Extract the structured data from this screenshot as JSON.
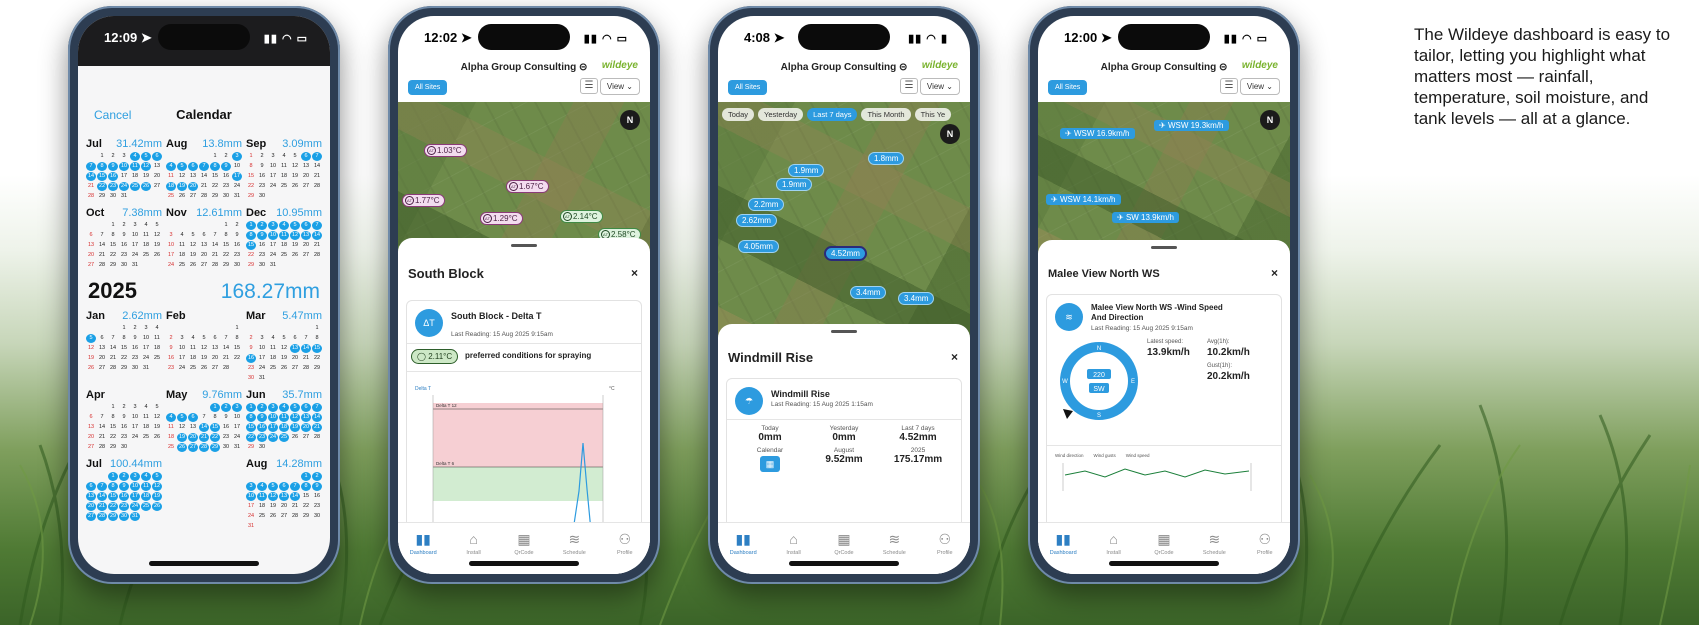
{
  "caption": "The Wildeye dashboard is easy to tailor, letting you highlight what matters most — rainfall, temperature, soil moisture, and tank levels — all at a glance.",
  "tabbar": [
    {
      "label": "Dashboard",
      "icon": "chart-icon"
    },
    {
      "label": "Install",
      "icon": "home-icon"
    },
    {
      "label": "QrCode",
      "icon": "qrcode-icon"
    },
    {
      "label": "Schedule",
      "icon": "waves-icon"
    },
    {
      "label": "Profile",
      "icon": "person-icon"
    }
  ],
  "header": {
    "org": "Alpha Group Consulting ⊝",
    "logo": "wildeye",
    "all_sites": "All Sites",
    "view": "View ⌄"
  },
  "phone1": {
    "time": "12:09 ➤",
    "cancel": "Cancel",
    "title": "Calendar",
    "year": "2025",
    "year_total": "168.27mm",
    "months_2024": [
      {
        "name": "Jul",
        "total": "31.42mm"
      },
      {
        "name": "Aug",
        "total": "13.8mm"
      },
      {
        "name": "Sep",
        "total": "3.09mm"
      },
      {
        "name": "Oct",
        "total": "7.38mm"
      },
      {
        "name": "Nov",
        "total": "12.61mm"
      },
      {
        "name": "Dec",
        "total": "10.95mm"
      }
    ],
    "months_2025": [
      {
        "name": "Jan",
        "total": "2.62mm"
      },
      {
        "name": "Feb",
        "total": ""
      },
      {
        "name": "Mar",
        "total": "5.47mm"
      },
      {
        "name": "Apr",
        "total": ""
      },
      {
        "name": "May",
        "total": "9.76mm"
      },
      {
        "name": "Jun",
        "total": "35.7mm"
      },
      {
        "name": "Jul",
        "total": "100.44mm"
      },
      {
        "name": "Aug",
        "total": "14.28mm"
      },
      {
        "name": "",
        "total": ""
      }
    ]
  },
  "phone2": {
    "time": "12:02 ➤",
    "pins": [
      "1.03°C",
      "1.77°C",
      "1.67°C",
      "1.29°C",
      "2.14°C",
      "2.58°C"
    ],
    "sheet_title": "South Block",
    "close": "×",
    "card_title": "South Block - Delta T",
    "badge": "ΔT",
    "last_reading": "Last Reading: 15 Aug 2025 9:15am",
    "reading_value": "2.11°C",
    "reading_text": "preferred conditions for spraying",
    "chart_unit_left": "Delta T",
    "chart_unit_right": "°C",
    "band_high": "Delta T 12",
    "band_low": "Delta T 6"
  },
  "phone3": {
    "time": "4:08 ➤",
    "chips": [
      "Today",
      "Yesterday",
      "Last 7 days",
      "This Month",
      "This Ye"
    ],
    "pins": [
      "1.8mm",
      "1.9mm",
      "1.9mm",
      "2.2mm",
      "2.62mm",
      "4.05mm",
      "4.52mm",
      "3.4mm",
      "3.4mm"
    ],
    "sheet_title": "Windmill Rise",
    "close": "×",
    "card_title": "Windmill Rise",
    "last_reading": "Last Reading: 15 Aug 2025 1:15am",
    "stats": [
      {
        "label": "Today",
        "value": "0mm"
      },
      {
        "label": "Yesterday",
        "value": "0mm"
      },
      {
        "label": "Last 7 days",
        "value": "4.52mm"
      },
      {
        "label": "Calendar",
        "value": ""
      },
      {
        "label": "August",
        "value": "9.52mm"
      },
      {
        "label": "2025",
        "value": "175.17mm"
      }
    ]
  },
  "phone4": {
    "time": "12:00 ➤",
    "pins": [
      "WSW 16.9km/h",
      "WSW 19.3km/h",
      "WSW 14.1km/h",
      "SW 13.9km/h"
    ],
    "sheet_title": "Malee View North WS",
    "close": "×",
    "card_title": "Malee View North WS -Wind Speed And Direction",
    "last_reading": "Last Reading: 15 Aug 2025 9:15am",
    "latest_label": "Latest speed:",
    "latest_value": "13.9km/h",
    "avg_label": "Avg(1h):",
    "avg_value": "10.2km/h",
    "gust_label": "Gust(1h):",
    "gust_value": "20.2km/h",
    "compass_deg": "220",
    "compass_dir": "SW",
    "compass_n": "N",
    "compass_s": "S",
    "compass_e": "E",
    "compass_w": "W",
    "legend": [
      "Wind direction",
      "Wind gusts",
      "Wind speed"
    ]
  },
  "colors": {
    "accent": "#2d9bdf",
    "brand": "#7ab32e"
  }
}
